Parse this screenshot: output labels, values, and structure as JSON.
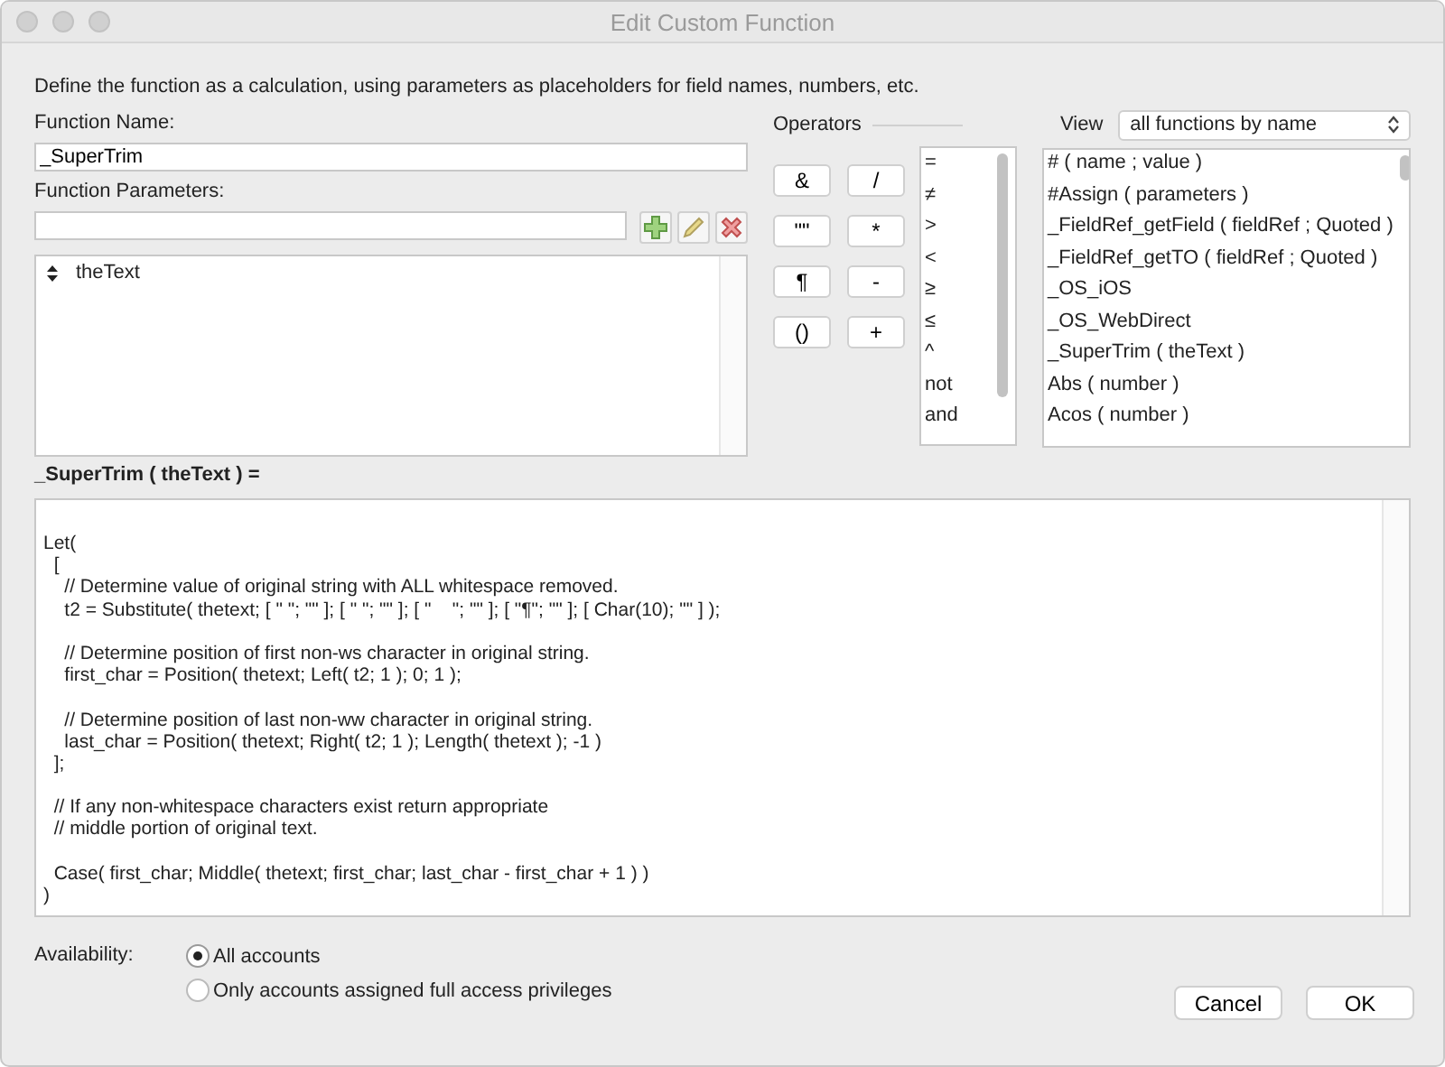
{
  "window": {
    "title": "Edit Custom Function"
  },
  "description": "Define the function as a calculation, using parameters as placeholders for field names, numbers, etc.",
  "function_name": {
    "label": "Function Name:",
    "value": "_SuperTrim"
  },
  "function_parameters": {
    "label": "Function Parameters:",
    "items": [
      "theText"
    ]
  },
  "operators": {
    "label": "Operators",
    "buttons": [
      "&",
      "/",
      "\"\"",
      "*",
      "¶",
      "-",
      "()",
      "+"
    ],
    "list": [
      "=",
      "≠",
      ">",
      "<",
      "≥",
      "≤",
      "^",
      "not",
      "and"
    ]
  },
  "view": {
    "label": "View",
    "value": "all functions by name"
  },
  "functions": [
    "# ( name ; value )",
    "#Assign ( parameters )",
    "_FieldRef_getField ( fieldRef ; Quoted )",
    "_FieldRef_getTO ( fieldRef ; Quoted )",
    "_OS_iOS",
    "_OS_WebDirect",
    "_SuperTrim ( theText )",
    "Abs ( number )",
    "Acos ( number )"
  ],
  "formula_header": "_SuperTrim ( theText ) =",
  "formula": [
    [
      "Let(",
      "  [",
      "    // Determine value of original string with ALL whitespace removed.",
      "    t2 = Substitute( thetext; [ \" \"; \"\" ]; [ \" \"; \"\" ]; [ \"    \"; \"\" ]; [ \"¶\"; \"\" ]; [ Char(10); \"\" ] );"
    ],
    [
      "    // Determine position of first non-ws character in original string.",
      "    first_char = Position( thetext; Left( t2; 1 ); 0; 1 );"
    ],
    [
      "    // Determine position of last non-ww character in original string.",
      "    last_char = Position( thetext; Right( t2; 1 ); Length( thetext ); -1 )",
      "  ];"
    ],
    [
      "  // If any non-whitespace characters exist return appropriate",
      "  // middle portion of original text."
    ],
    [
      "  Case( first_char; Middle( thetext; first_char; last_char - first_char + 1 ) )",
      ")"
    ]
  ],
  "availability": {
    "label": "Availability:",
    "options": [
      {
        "label": "All accounts",
        "selected": true
      },
      {
        "label": "Only accounts assigned full access privileges",
        "selected": false
      }
    ]
  },
  "buttons": [
    "Cancel",
    "OK"
  ]
}
